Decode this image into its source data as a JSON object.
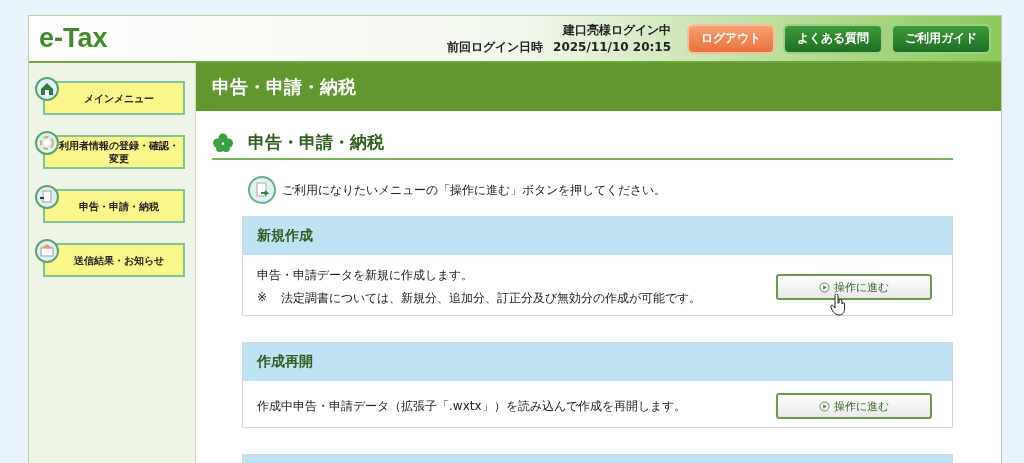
{
  "header": {
    "logo": "e-Tax",
    "user_status": "建口亮様ログイン中",
    "last_login_label": "前回ログイン日時",
    "last_login_time": "2025/11/10 20:15",
    "buttons": [
      {
        "label": "ログアウト",
        "kind": "logout"
      },
      {
        "label": "よくある質問",
        "kind": "nav"
      },
      {
        "label": "ご利用ガイド",
        "kind": "nav"
      }
    ]
  },
  "sidebar": {
    "items": [
      {
        "label": "メインメニュー",
        "kind": "home"
      },
      {
        "label": "利用者情報の登録・確認・変更",
        "kind": "cycle"
      },
      {
        "label": "申告・申請・納税",
        "kind": "document"
      },
      {
        "label": "送信結果・お知らせ",
        "kind": "mail"
      }
    ]
  },
  "page_title": "申告・申請・納税",
  "heading": "申告・申請・納税",
  "instruction": "ご利用になりたいメニューの「操作に進む」ボタンを押してください。",
  "sections": [
    {
      "title": "新規作成",
      "lines": [
        {
          "kind": "text",
          "text": "申告・申請データを新規に作成します。"
        },
        {
          "kind": "note",
          "mark": "※",
          "text": "法定調書については、新規分、追加分、訂正分及び無効分の作成が可能です。"
        }
      ],
      "button": "操作に進む",
      "hovered": true
    },
    {
      "title": "作成再開",
      "lines": [
        {
          "kind": "text",
          "text": "作成中申告・申請データ（拡張子「.wxtx」）を読み込んで作成を再開します。"
        }
      ],
      "button": "操作に進む",
      "hovered": false
    }
  ],
  "partial_section": true
}
